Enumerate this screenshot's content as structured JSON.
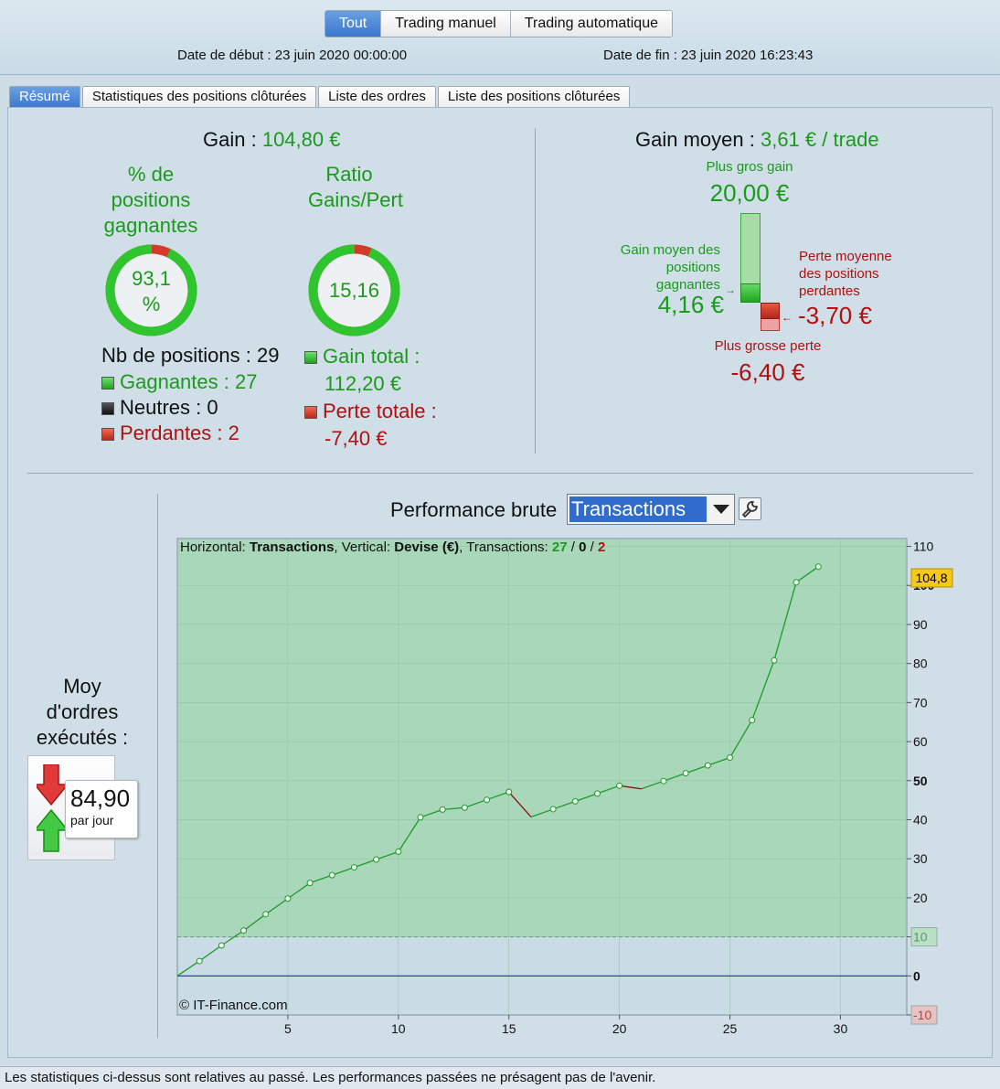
{
  "modes": [
    "Tout",
    "Trading manuel",
    "Trading automatique"
  ],
  "dates": {
    "start": "Date de début : 23 juin 2020 00:00:00",
    "end": "Date de fin : 23 juin 2020 16:23:43"
  },
  "tabs": [
    "Résumé",
    "Statistiques des positions clôturées",
    "Liste des ordres",
    "Liste des positions clôturées"
  ],
  "summary": {
    "gain_label": "Gain :",
    "gain_value": "104,80 €",
    "pct_title_1": "% de",
    "pct_title_2": "positions",
    "pct_title_3": "gagnantes",
    "pct_value_1": "93,1",
    "pct_value_2": "%",
    "pct_fraction": 0.931,
    "ratio_title_1": "Ratio",
    "ratio_title_2": "Gains/Pert",
    "ratio_value": "15,16",
    "ratio_fraction": 0.938,
    "nb_positions": "Nb de positions : 29",
    "gagnantes": "Gagnantes : 27",
    "neutres": "Neutres : 0",
    "perdantes": "Perdantes : 2",
    "gain_total_label": "Gain total :",
    "gain_total_value": "112,20 €",
    "perte_totale_label": "Perte totale :",
    "perte_totale_value": "-7,40 €",
    "gain_moyen_label": "Gain moyen :",
    "gain_moyen_value": "3,61 € / trade",
    "plus_gros_gain_label": "Plus gros gain",
    "plus_gros_gain_value": "20,00 €",
    "gain_moyen_pos_1": "Gain moyen des",
    "gain_moyen_pos_2": "positions",
    "gain_moyen_pos_3": "gagnantes",
    "gain_moyen_pos_value": "4,16 €",
    "perte_moyenne_1": "Perte moyenne",
    "perte_moyenne_2": "des positions",
    "perte_moyenne_3": "perdantes",
    "perte_moyenne_value": "-3,70 €",
    "plus_grosse_perte_label": "Plus grosse perte",
    "plus_grosse_perte_value": "-6,40 €"
  },
  "orders": {
    "title_1": "Moy",
    "title_2": "d'ordres",
    "title_3": "exécutés :",
    "value": "84,90",
    "unit": "par jour"
  },
  "perf": {
    "title": "Performance brute",
    "dropdown_value": "Transactions",
    "info_horizontal": "Horizontal: ",
    "info_h_value": "Transactions",
    "info_vertical": ", Vertical: ",
    "info_v_value": "Devise (€)",
    "info_trans": ", Transactions: ",
    "info_win": "27",
    "info_sep": " / ",
    "info_neutral": "0",
    "info_loss": "2",
    "copyright": "© IT-Finance.com",
    "last_value_label": "104,8"
  },
  "colors": {
    "gain": "#1b9a1b",
    "loss": "#b01010",
    "plot_green": "#a8d8b9",
    "plot_below": "#c9dce6"
  },
  "chart_data": {
    "type": "line",
    "xlabel": "",
    "ylabel": "",
    "x_ticks": [
      "5",
      "10",
      "15",
      "20",
      "25",
      "30"
    ],
    "y_ticks": [
      "-10",
      "0",
      "10",
      "20",
      "30",
      "40",
      "50",
      "60",
      "70",
      "80",
      "90",
      "100",
      "110"
    ],
    "xlim": [
      0,
      33
    ],
    "ylim": [
      -10,
      112
    ],
    "x": [
      0,
      1,
      2,
      3,
      4,
      5,
      6,
      7,
      8,
      9,
      10,
      11,
      12,
      13,
      14,
      15,
      16,
      17,
      18,
      19,
      20,
      21,
      22,
      23,
      24,
      25,
      26,
      27,
      28,
      29
    ],
    "y": [
      0,
      3.8,
      7.8,
      11.6,
      15.8,
      19.8,
      23.8,
      25.8,
      27.8,
      29.8,
      31.8,
      40.6,
      42.6,
      43.1,
      45.1,
      47.1,
      40.7,
      42.7,
      44.7,
      46.7,
      48.7,
      47.9,
      49.9,
      51.9,
      53.9,
      55.9,
      65.5,
      80.8,
      100.8,
      104.8
    ],
    "loss_segments": [
      [
        15,
        16
      ],
      [
        20,
        21
      ]
    ],
    "grid": true,
    "threshold_line": 10
  }
}
